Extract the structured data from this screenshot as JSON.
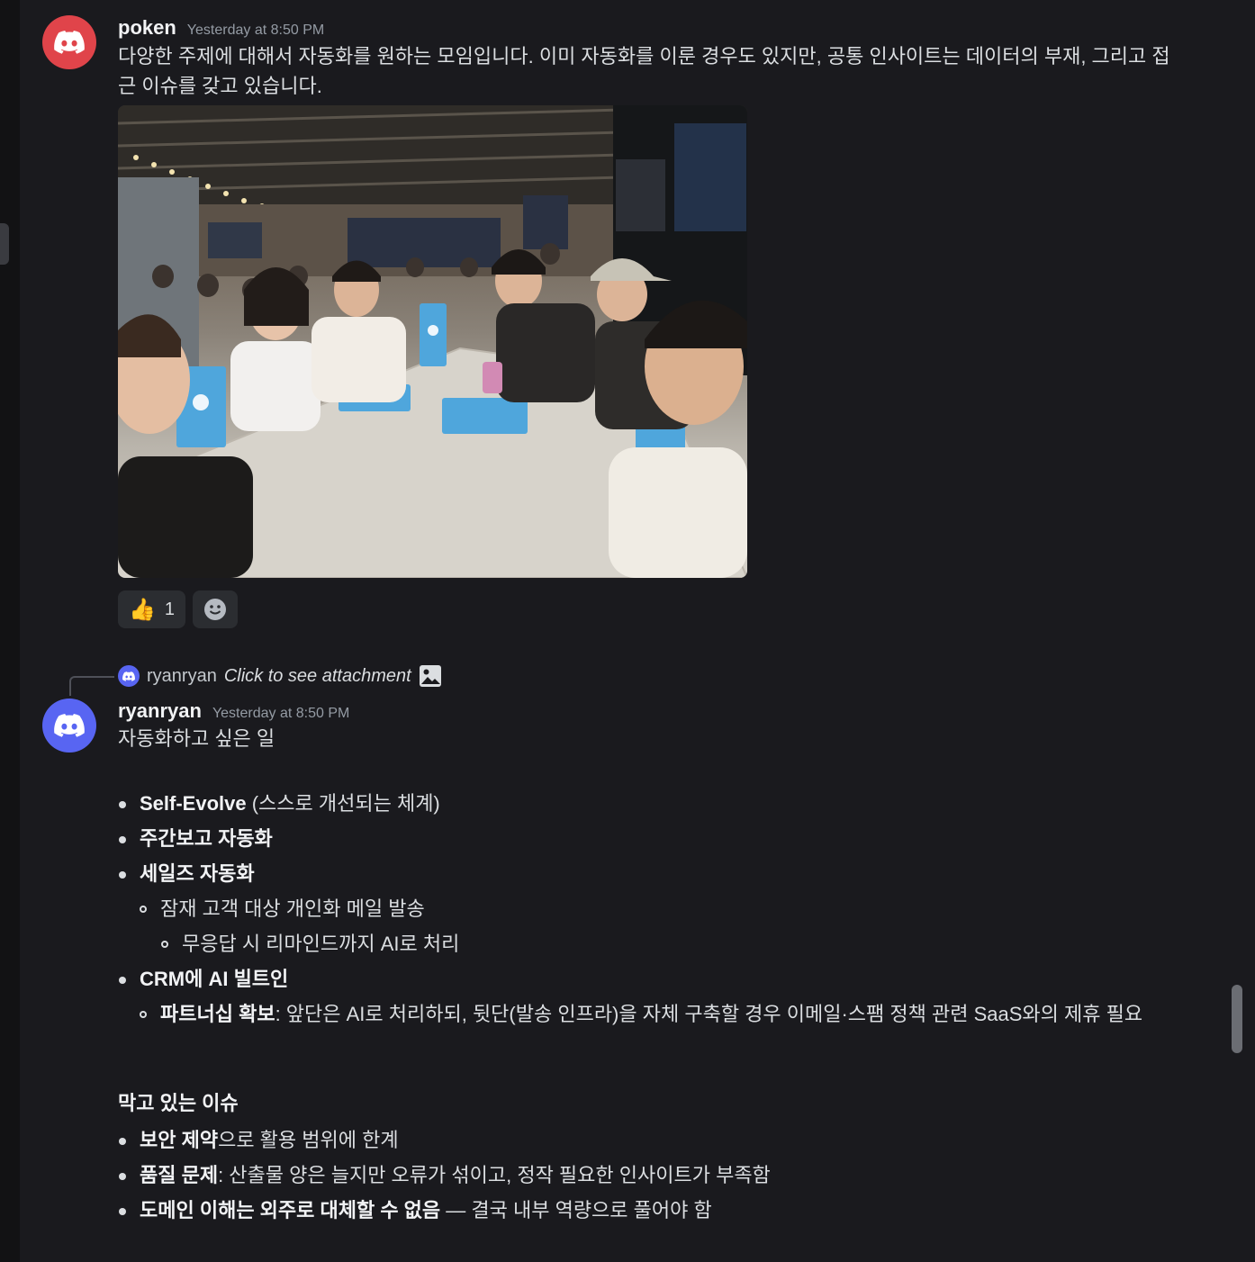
{
  "messages": [
    {
      "username": "poken",
      "timestamp": "Yesterday at 8:50 PM",
      "line1": "다양한 주제에 대해서 자동화를 원하는 모임입니다. 이미 자동화를 이룬 경우도 있지만, 공통 인사이트는 데이터의 부재, 그리고 접",
      "line2": "근 이슈를 갖고 있습니다.",
      "reactions": [
        {
          "emoji": "👍",
          "count": "1"
        }
      ]
    },
    {
      "reply": {
        "username": "ryanryan",
        "text": "Click to see attachment"
      },
      "username": "ryanryan",
      "timestamp": "Yesterday at 8:50 PM",
      "intro": "자동화하고 싶은 일",
      "items": {
        "i1_bold": "Self-Evolve",
        "i1_rest": " (스스로 개선되는 체계)",
        "i2_bold": "주간보고 자동화",
        "i3_bold": "세일즈 자동화",
        "i3a": "잠재 고객 대상 개인화 메일 발송",
        "i3b": "무응답 시 리마인드까지 AI로 처리",
        "i4_bold": "CRM에 AI 빌트인",
        "i4a_bold": "파트너십 확보",
        "i4a_rest": ": 앞단은 AI로 처리하되, 뒷단(발송 인프라)을 자체 구축할 경우 이메일·스팸 정책 관련 SaaS와의 제휴 필요"
      },
      "issues_heading": "막고 있는 이슈",
      "issues": {
        "j1_bold": "보안 제약",
        "j1_rest": "으로 활용 범위에 한계",
        "j2_bold": "품질 문제",
        "j2_rest": ": 산출물 양은 늘지만 오류가 섞이고, 정작 필요한 인사이트가 부족함",
        "j3_bold": "도메인 이해는 외주로 대체할 수 없음",
        "j3_rest": " — 결국 내부 역량으로 풀어야 함"
      }
    }
  ]
}
